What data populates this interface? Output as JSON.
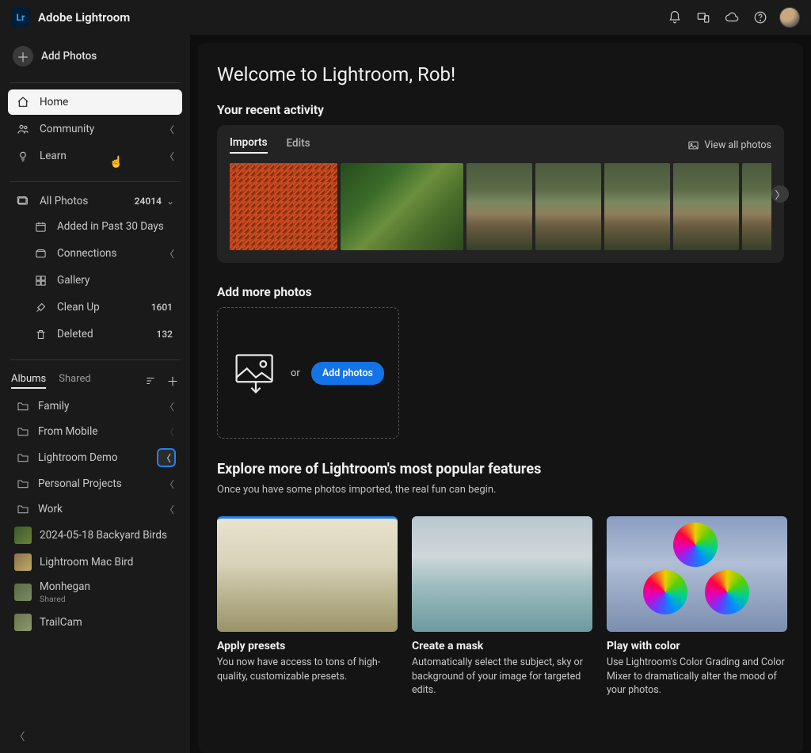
{
  "app_title": "Adobe Lightroom",
  "logo_text": "Lr",
  "add_photos_label": "Add Photos",
  "nav": {
    "home": "Home",
    "community": "Community",
    "learn": "Learn"
  },
  "library": {
    "all_photos": "All Photos",
    "all_photos_count": "24014",
    "added_30": "Added in Past 30 Days",
    "connections": "Connections",
    "gallery": "Gallery",
    "cleanup": "Clean Up",
    "cleanup_count": "1601",
    "deleted": "Deleted",
    "deleted_count": "132"
  },
  "albums_tab": "Albums",
  "shared_tab": "Shared",
  "folders": [
    {
      "name": "Family"
    },
    {
      "name": "From Mobile"
    },
    {
      "name": "Lightroom Demo"
    },
    {
      "name": "Personal Projects"
    },
    {
      "name": "Work"
    }
  ],
  "thumb_albums": [
    {
      "name": "2024-05-18 Backyard Birds"
    },
    {
      "name": "Lightroom Mac Bird"
    },
    {
      "name": "Monhegan",
      "sub": "Shared"
    },
    {
      "name": "TrailCam"
    }
  ],
  "welcome": "Welcome to Lightroom, Rob!",
  "recent_title": "Your recent activity",
  "recent_tabs": {
    "imports": "Imports",
    "edits": "Edits"
  },
  "view_all": "View all photos",
  "addmore_title": "Add more photos",
  "addmore_or": "or",
  "addmore_btn": "Add photos",
  "explore_title": "Explore more of Lightroom's most popular features",
  "explore_sub": "Once you have some photos imported, the real fun can begin.",
  "cards": [
    {
      "title": "Apply presets",
      "desc": "You now have access to tons of high-quality, customizable presets."
    },
    {
      "title": "Create a mask",
      "desc": "Automatically select the subject, sky or background of your image for targeted edits."
    },
    {
      "title": "Play with color",
      "desc": "Use Lightroom's Color Grading and Color Mixer to dramatically alter the mood of your photos."
    }
  ]
}
